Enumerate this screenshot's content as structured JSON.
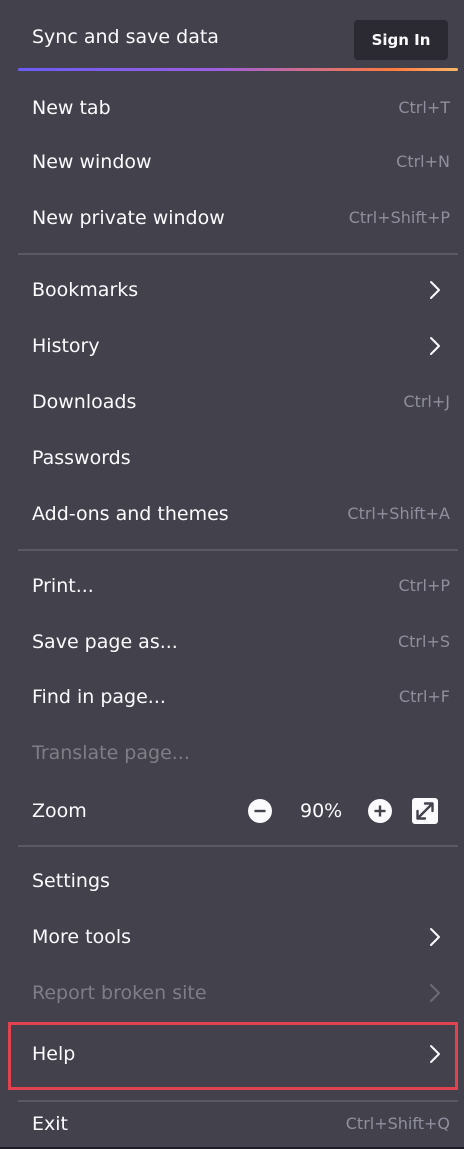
{
  "header": {
    "title": "Sync and save data",
    "signin_label": "Sign In"
  },
  "colors": {
    "menu_bg": "#43414b",
    "text": "#fbfbfe",
    "shortcut_text": "#8f8f9d",
    "disabled_text": "#7f7e86",
    "highlight": "#e0424f",
    "accent_gradient": [
      "#6a5cf6",
      "#9d5fe0",
      "#ff7a3d",
      "#ffb46a"
    ]
  },
  "items": {
    "new_tab": {
      "label": "New tab",
      "shortcut": "Ctrl+T"
    },
    "new_window": {
      "label": "New window",
      "shortcut": "Ctrl+N"
    },
    "new_private_window": {
      "label": "New private window",
      "shortcut": "Ctrl+Shift+P"
    },
    "bookmarks": {
      "label": "Bookmarks",
      "icon": "chevron-right-icon"
    },
    "history": {
      "label": "History",
      "icon": "chevron-right-icon"
    },
    "downloads": {
      "label": "Downloads",
      "shortcut": "Ctrl+J"
    },
    "passwords": {
      "label": "Passwords"
    },
    "addons": {
      "label": "Add-ons and themes",
      "shortcut": "Ctrl+Shift+A"
    },
    "print": {
      "label": "Print...",
      "shortcut": "Ctrl+P"
    },
    "save_page": {
      "label": "Save page as...",
      "shortcut": "Ctrl+S"
    },
    "find_in_page": {
      "label": "Find in page...",
      "shortcut": "Ctrl+F"
    },
    "translate_page": {
      "label": "Translate page...",
      "disabled": true
    },
    "zoom": {
      "label": "Zoom",
      "value": "90%",
      "icons": [
        "zoom-out-icon",
        "zoom-in-icon",
        "fullscreen-icon"
      ]
    },
    "settings": {
      "label": "Settings"
    },
    "more_tools": {
      "label": "More tools",
      "icon": "chevron-right-icon"
    },
    "report_broken_site": {
      "label": "Report broken site",
      "disabled": true,
      "icon": "chevron-right-icon"
    },
    "help": {
      "label": "Help",
      "icon": "chevron-right-icon",
      "highlighted": true
    },
    "exit": {
      "label": "Exit",
      "shortcut": "Ctrl+Shift+Q"
    }
  }
}
